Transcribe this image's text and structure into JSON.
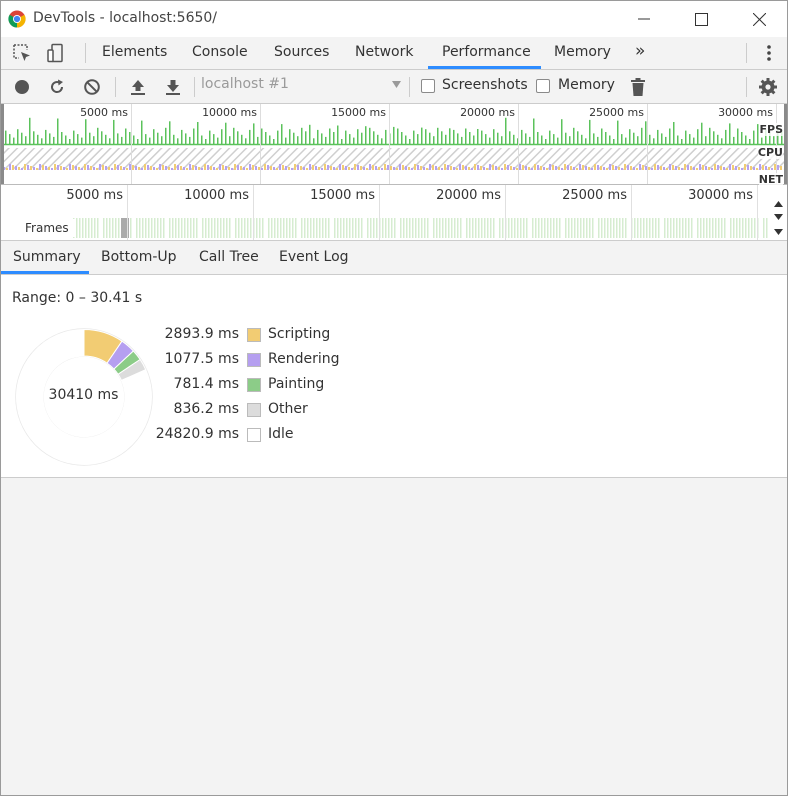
{
  "window": {
    "title": "DevTools - localhost:5650/"
  },
  "tabs": [
    {
      "label": "Elements"
    },
    {
      "label": "Console"
    },
    {
      "label": "Sources"
    },
    {
      "label": "Network"
    },
    {
      "label": "Performance",
      "active": true
    },
    {
      "label": "Memory"
    }
  ],
  "toolbar": {
    "more_tabs_glyph": "»",
    "profile_select": "localhost #1",
    "screenshots_label": "Screenshots",
    "memory_label": "Memory"
  },
  "overview": {
    "ticks": [
      "5000 ms",
      "10000 ms",
      "15000 ms",
      "20000 ms",
      "25000 ms",
      "30000 ms"
    ],
    "lanes": [
      "FPS",
      "CPU",
      "NET"
    ]
  },
  "timeline": {
    "ticks": [
      "5000 ms",
      "10000 ms",
      "15000 ms",
      "20000 ms",
      "25000 ms",
      "30000 ms"
    ],
    "frames_label": "Frames"
  },
  "bottom_tabs": [
    {
      "label": "Summary",
      "active": true
    },
    {
      "label": "Bottom-Up"
    },
    {
      "label": "Call Tree"
    },
    {
      "label": "Event Log"
    }
  ],
  "summary": {
    "range": "Range: 0 – 30.41 s",
    "total": "30410 ms",
    "items": [
      {
        "value": "2893.9 ms",
        "name": "Scripting",
        "ms": 2893.9,
        "color": "#f2cc73"
      },
      {
        "value": "1077.5 ms",
        "name": "Rendering",
        "ms": 1077.5,
        "color": "#b59ff0"
      },
      {
        "value": "781.4 ms",
        "name": "Painting",
        "ms": 781.4,
        "color": "#8ccc88"
      },
      {
        "value": "836.2 ms",
        "name": "Other",
        "ms": 836.2,
        "color": "#dcdcdc"
      },
      {
        "value": "24820.9 ms",
        "name": "Idle",
        "ms": 24820.9,
        "color": "#ffffff"
      }
    ]
  },
  "colors": {
    "accent": "#2d8cff",
    "fps_green": "#5bc25b"
  }
}
